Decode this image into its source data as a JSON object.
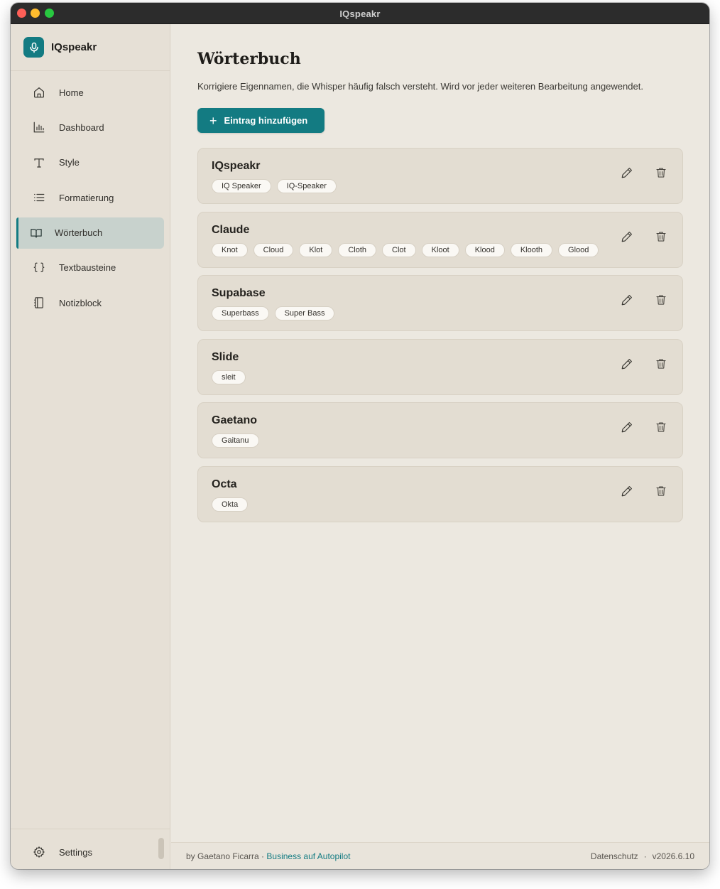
{
  "window": {
    "title": "IQspeakr"
  },
  "sidebar": {
    "brand": "IQspeakr",
    "items": [
      {
        "label": "Home",
        "icon": "home-icon"
      },
      {
        "label": "Dashboard",
        "icon": "bar-chart-icon"
      },
      {
        "label": "Style",
        "icon": "text-style-icon"
      },
      {
        "label": "Formatierung",
        "icon": "list-icon"
      },
      {
        "label": "Wörterbuch",
        "icon": "book-icon",
        "active": true
      },
      {
        "label": "Textbausteine",
        "icon": "braces-icon"
      },
      {
        "label": "Notizblock",
        "icon": "notebook-icon"
      }
    ],
    "settings_label": "Settings"
  },
  "main": {
    "title": "Wörterbuch",
    "description": "Korrigiere Eigennamen, die Whisper häufig falsch versteht. Wird vor jeder weiteren Bearbeitung angewendet.",
    "add_button": {
      "icon": "+",
      "label": "Eintrag hinzufügen"
    },
    "entries": [
      {
        "term": "IQspeakr",
        "variants": [
          "IQ Speaker",
          "IQ-Speaker"
        ]
      },
      {
        "term": "Claude",
        "variants": [
          "Knot",
          "Cloud",
          "Klot",
          "Cloth",
          "Clot",
          "Kloot",
          "Klood",
          "Klooth",
          "Glood"
        ]
      },
      {
        "term": "Supabase",
        "variants": [
          "Superbass",
          "Super Bass"
        ]
      },
      {
        "term": "Slide",
        "variants": [
          "sleit"
        ]
      },
      {
        "term": "Gaetano",
        "variants": [
          "Gaitanu"
        ]
      },
      {
        "term": "Octa",
        "variants": [
          "Okta"
        ]
      }
    ]
  },
  "footer": {
    "by_text": "by Gaetano Ficarra · ",
    "link_text": "Business auf Autopilot",
    "privacy": "Datenschutz",
    "separator": "·",
    "version": "v2026.6.10"
  },
  "colors": {
    "accent": "#137b82",
    "sidebar_bg": "#e6e0d6",
    "main_bg": "#ece8e0",
    "card_bg": "#e3ddd2",
    "active_nav_bg": "#c8d2cd"
  }
}
